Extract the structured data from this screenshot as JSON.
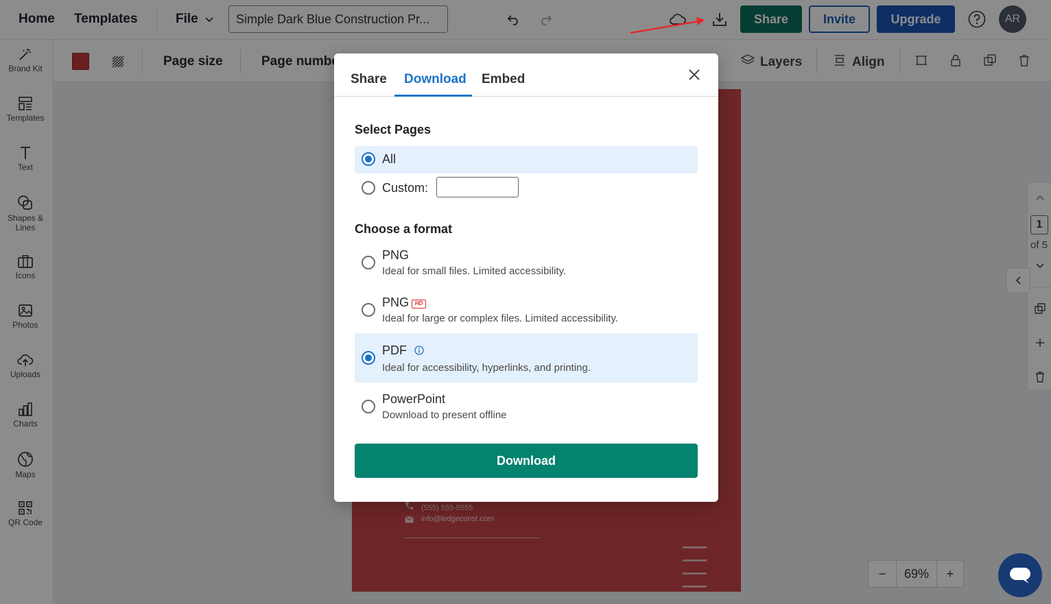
{
  "topbar": {
    "home": "Home",
    "templates": "Templates",
    "file": "File",
    "document_title": "Simple Dark Blue Construction Pr...",
    "share": "Share",
    "invite": "Invite",
    "upgrade": "Upgrade",
    "avatar_initials": "AR"
  },
  "sidebar": {
    "items": [
      {
        "label": "Brand Kit",
        "icon": "magic-wand-icon"
      },
      {
        "label": "Templates",
        "icon": "templates-icon"
      },
      {
        "label": "Text",
        "icon": "text-icon"
      },
      {
        "label": "Shapes & Lines",
        "icon": "shapes-icon"
      },
      {
        "label": "Icons",
        "icon": "briefcase-icon"
      },
      {
        "label": "Photos",
        "icon": "image-icon"
      },
      {
        "label": "Uploads",
        "icon": "upload-cloud-icon"
      },
      {
        "label": "Charts",
        "icon": "bar-chart-icon"
      },
      {
        "label": "Maps",
        "icon": "globe-icon"
      },
      {
        "label": "QR Code",
        "icon": "qr-code-icon"
      }
    ]
  },
  "toolbar": {
    "page_size": "Page size",
    "page_number": "Page numbe",
    "layers": "Layers",
    "align": "Align",
    "swatch_color": "#c0393b"
  },
  "canvas": {
    "phone": "(555) 555-5555",
    "email": "info@ledgeconst.com",
    "page_color": "#c94447"
  },
  "pager": {
    "current": "1",
    "of": "of 5"
  },
  "zoom": {
    "minus": "−",
    "value": "69%",
    "plus": "+"
  },
  "modal": {
    "tabs": [
      "Share",
      "Download",
      "Embed"
    ],
    "active_tab": "Download",
    "select_pages_title": "Select Pages",
    "page_options": {
      "all": "All",
      "custom": "Custom:",
      "custom_value": "",
      "selected": "All"
    },
    "format_title": "Choose a format",
    "formats": [
      {
        "label": "PNG",
        "desc": "Ideal for small files. Limited accessibility."
      },
      {
        "label": "PNG",
        "badge": "HD",
        "desc": "Ideal for large or complex files. Limited accessibility."
      },
      {
        "label": "PDF",
        "desc": "Ideal for accessibility, hyperlinks, and printing."
      },
      {
        "label": "PowerPoint",
        "desc": "Download to present offline"
      }
    ],
    "selected_format": "PDF",
    "download_button": "Download",
    "accent_color": "#1a73c8",
    "download_color": "#04836f"
  }
}
